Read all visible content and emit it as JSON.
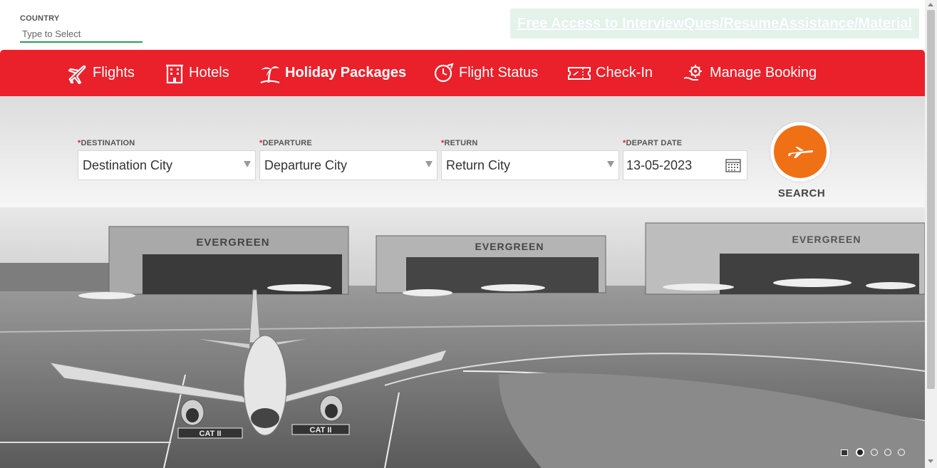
{
  "country": {
    "label": "COUNTRY",
    "placeholder": "Type to Select",
    "value": ""
  },
  "promo": {
    "link_text": "Free Access to InterviewQues/ResumeAssistance/Material"
  },
  "nav": {
    "items": [
      {
        "label": "Flights",
        "icon": "airplane-icon"
      },
      {
        "label": "Hotels",
        "icon": "hotel-building-icon"
      },
      {
        "label": "Holiday Packages",
        "icon": "palm-tree-icon",
        "active": true
      },
      {
        "label": "Flight Status",
        "icon": "clock-plane-icon"
      },
      {
        "label": "Check-In",
        "icon": "ticket-icon"
      },
      {
        "label": "Manage Booking",
        "icon": "gear-hand-icon"
      }
    ]
  },
  "search": {
    "required_marker": "*",
    "destination": {
      "label": "DESTINATION",
      "value": "Destination City"
    },
    "departure": {
      "label": "DEPARTURE",
      "value": "Departure City"
    },
    "return": {
      "label": "RETURN",
      "value": "Return City"
    },
    "depart_date": {
      "label": "DEPART DATE",
      "value": "13-05-2023"
    },
    "button_label": "SEARCH"
  },
  "hero": {
    "hangar_signs": [
      "EVERGREEN",
      "EVERGREEN",
      "EVERGREEN"
    ],
    "runway_markings": [
      "CAT II",
      "CAT II"
    ],
    "slides_total": 4,
    "slide_active": 1
  },
  "colors": {
    "nav_red": "#ea202a",
    "search_orange": "#f07016",
    "underline_green": "#2e9a58",
    "promo_bg": "#e4f3ea"
  }
}
